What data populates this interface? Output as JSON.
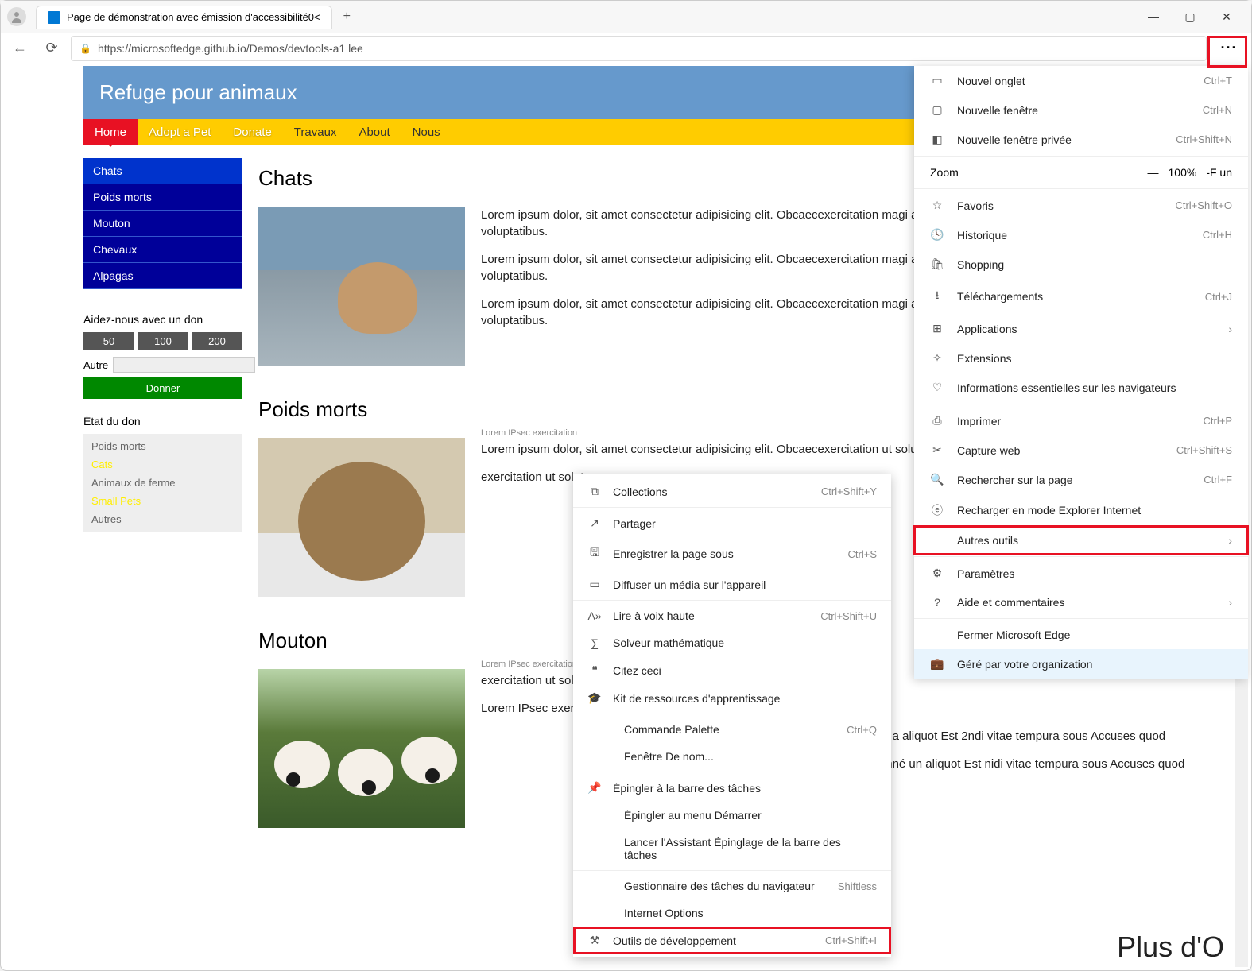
{
  "titlebar": {
    "tab_title": "Page de démonstration avec émission d'accessibilité0<",
    "new_tab": "+",
    "minimize": "—",
    "maximize": "▢",
    "close": "✕"
  },
  "addrbar": {
    "back": "←",
    "refresh": "⟳",
    "lock": "🔒",
    "url": "https://microsoftedge.github.io/Demos/devtools-a1 lee",
    "more": "···"
  },
  "page": {
    "banner": "Refuge pour animaux",
    "nav": [
      {
        "label": "Home",
        "cls": "active"
      },
      {
        "label": "Adopt a Pet",
        "cls": "white"
      },
      {
        "label": "Donate",
        "cls": "white"
      },
      {
        "label": "Travaux",
        "cls": ""
      },
      {
        "label": "About",
        "cls": ""
      },
      {
        "label": "Nous",
        "cls": ""
      }
    ],
    "sidebar": [
      "Chats",
      "Poids morts",
      "Mouton",
      "Chevaux",
      "Alpagas"
    ],
    "donate": {
      "title": "Aidez-nous avec un don",
      "amounts": [
        "50",
        "100",
        "200"
      ],
      "other": "Autre",
      "button": "Donner"
    },
    "status": {
      "title": "État du don",
      "items": [
        {
          "t": "Poids morts",
          "c": ""
        },
        {
          "t": "Cats",
          "c": "y"
        },
        {
          "t": "Animaux de ferme",
          "c": ""
        },
        {
          "t": "Small Pets",
          "c": "y"
        },
        {
          "t": "Autres",
          "c": ""
        }
      ]
    },
    "sections": [
      {
        "title": "Chats",
        "img": "cat",
        "caption": "",
        "paras": [
          "Lorem ipsum dolor, sit amet consectetur adipisicing elit. Obcaecexercitation magi architect pianissimos distinction rem elegy ut soluta voluptatibus.",
          "Lorem ipsum dolor, sit amet consectetur adipisicing elit. Obcaecexercitation magi architect pianissimos distinction rem elegy ut soluta voluptatibus.",
          "Lorem ipsum dolor, sit amet consectetur adipisicing elit. Obcaecexercitation magi architect pianissimos distinction rem elegy ut soluta voluptatibus."
        ]
      },
      {
        "title": "Poids morts",
        "img": "dog",
        "caption": "Lorem IPsec exercitation",
        "paras": [
          "Lorem ipsum dolor, sit amet consectetur adipisicing elit. Obcaecexercitation ut soluta v",
          "exercitation ut soluta v"
        ]
      },
      {
        "title": "Mouton",
        "img": "sheep",
        "caption": "Lorem IPsec exercitation",
        "paras": [
          "exercitation ut soluta v",
          "Lorem IPsec exercitation ut soluta v"
        ],
        "extra": [
          "it quos corrupt rationed a aliquot Est 2ndi vitae tempura sous Accuses quod",
          "fit quos corrompu rationné un aliquot Est nidi vitae tempura sous Accuses quod"
        ]
      }
    ],
    "big": "Plus d'O"
  },
  "menu": {
    "items": [
      {
        "icon": "▭",
        "label": "Nouvel onglet",
        "short": "Ctrl+T"
      },
      {
        "icon": "▢",
        "label": "Nouvelle fenêtre",
        "short": "Ctrl+N"
      },
      {
        "icon": "◧",
        "label": "Nouvelle fenêtre privée",
        "short": "Ctrl+Shift+N"
      },
      {
        "sep": true
      },
      {
        "zoom": true,
        "label": "Zoom",
        "minus": "—",
        "pct": "100%",
        "full": "-F un"
      },
      {
        "sep": true
      },
      {
        "icon": "☆",
        "label": "Favoris",
        "short": "Ctrl+Shift+O"
      },
      {
        "icon": "🕓",
        "label": "Historique",
        "short": "Ctrl+H"
      },
      {
        "icon": "🛍",
        "label": "Shopping",
        "short": ""
      },
      {
        "icon": "⭳",
        "label": "Téléchargements",
        "short": "Ctrl+J"
      },
      {
        "icon": "⊞",
        "label": "Applications",
        "short": "",
        "chev": "›"
      },
      {
        "icon": "✧",
        "label": "Extensions",
        "short": ""
      },
      {
        "icon": "♡",
        "label": "Informations essentielles sur les navigateurs",
        "short": ""
      },
      {
        "sep": true
      },
      {
        "icon": "⎙",
        "label": "Imprimer",
        "short": "Ctrl+P"
      },
      {
        "icon": "✂",
        "label": "Capture web",
        "short": "Ctrl+Shift+S"
      },
      {
        "icon": "🔍",
        "label": "Rechercher sur la page",
        "short": "Ctrl+F"
      },
      {
        "icon": "ⓔ",
        "label": "Recharger en mode Explorer Internet",
        "short": ""
      },
      {
        "icon": "",
        "label": "Autres outils",
        "short": "",
        "chev": "›",
        "hl": true
      },
      {
        "sep": true
      },
      {
        "icon": "⚙",
        "label": "Paramètres",
        "short": ""
      },
      {
        "icon": "?",
        "label": "Aide et commentaires",
        "short": "",
        "chev": "›"
      },
      {
        "sep": true
      },
      {
        "icon": "",
        "label": "Fermer Microsoft Edge",
        "short": ""
      },
      {
        "icon": "💼",
        "label": "Géré par votre organization",
        "short": "",
        "managed": true
      }
    ]
  },
  "submenu": {
    "items": [
      {
        "icon": "⧉",
        "label": "Collections",
        "short": "Ctrl+Shift+Y"
      },
      {
        "sep": true
      },
      {
        "icon": "↗",
        "label": "Partager",
        "short": ""
      },
      {
        "icon": "🖫",
        "label": "Enregistrer la page sous",
        "short": "Ctrl+S"
      },
      {
        "icon": "▭",
        "label": "Diffuser un média sur l'appareil",
        "short": ""
      },
      {
        "sep": true
      },
      {
        "icon": "A»",
        "label": "Lire à voix haute",
        "short": "Ctrl+Shift+U"
      },
      {
        "icon": "∑",
        "label": "Solveur mathématique",
        "short": ""
      },
      {
        "icon": "❝",
        "label": "Citez ceci",
        "short": ""
      },
      {
        "icon": "🎓",
        "label": "Kit de ressources d'apprentissage",
        "short": ""
      },
      {
        "sep": true
      },
      {
        "icon": "",
        "label": "Commande Palette",
        "short": "Ctrl+Q",
        "indent": true
      },
      {
        "icon": "",
        "label": "Fenêtre De nom...",
        "short": "",
        "indent": true
      },
      {
        "sep": true
      },
      {
        "icon": "📌",
        "label": "Épingler à la barre des tâches",
        "short": ""
      },
      {
        "icon": "",
        "label": "Épingler au menu Démarrer",
        "short": "",
        "indent": true
      },
      {
        "icon": "",
        "label": "Lancer l'Assistant Épinglage de la barre des tâches",
        "short": "",
        "indent": true
      },
      {
        "sep": true
      },
      {
        "icon": "",
        "label": "Gestionnaire des tâches du navigateur",
        "short": "Shiftless",
        "indent": true
      },
      {
        "icon": "",
        "label": "Internet Options",
        "short": "",
        "indent": true
      },
      {
        "icon": "⚒",
        "label": "Outils de développement",
        "short": "Ctrl+Shift+I",
        "hl": true
      }
    ]
  }
}
